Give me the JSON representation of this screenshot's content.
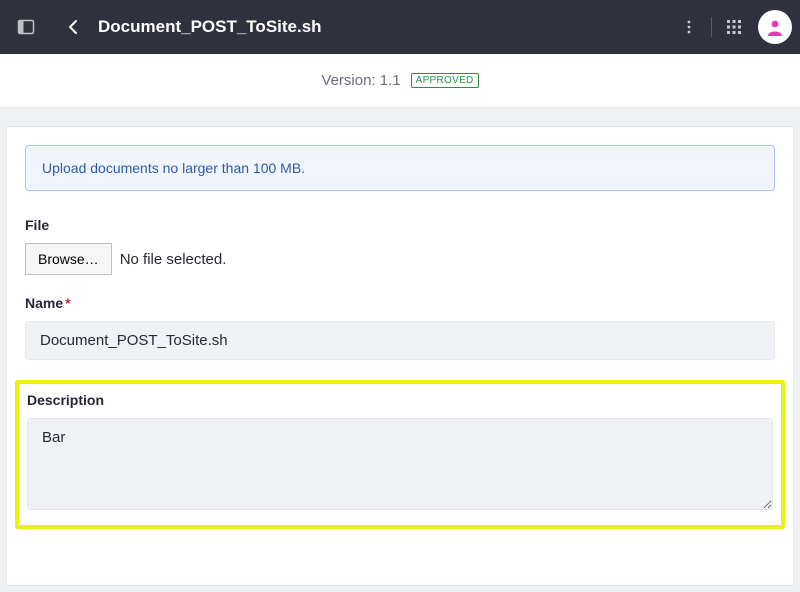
{
  "header": {
    "title": "Document_POST_ToSite.sh"
  },
  "version": {
    "label": "Version: 1.1",
    "status": "APPROVED"
  },
  "banner": {
    "text": "Upload documents no larger than 100 MB."
  },
  "form": {
    "file": {
      "label": "File",
      "browse": "Browse…",
      "status": "No file selected."
    },
    "name": {
      "label": "Name",
      "value": "Document_POST_ToSite.sh"
    },
    "description": {
      "label": "Description",
      "value": "Bar"
    }
  }
}
